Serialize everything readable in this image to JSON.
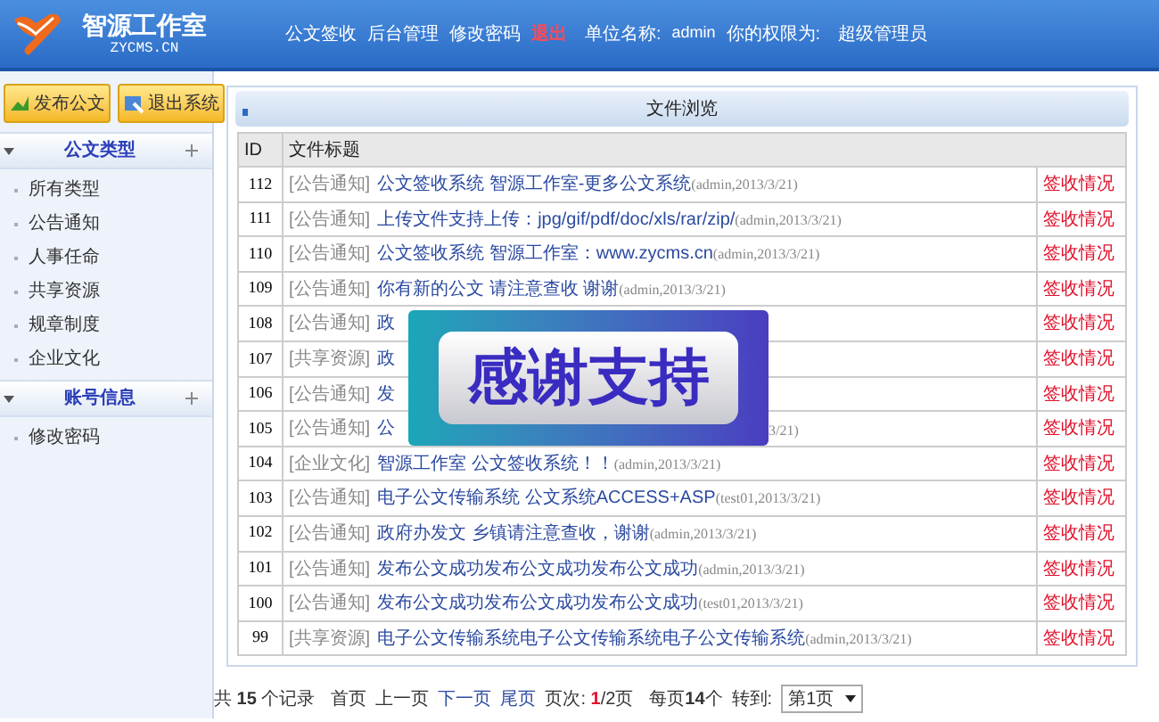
{
  "header": {
    "brand": "智源工作室",
    "domain": "ZYCMS.CN",
    "nav": [
      {
        "label": "公文签收",
        "kind": "link"
      },
      {
        "label": "后台管理",
        "kind": "link"
      },
      {
        "label": "修改密码",
        "kind": "link"
      },
      {
        "label": "退出",
        "kind": "logout"
      }
    ],
    "unit_label": "单位名称:",
    "unit_value": "admin",
    "role_label": "你的权限为:",
    "role_value": "超级管理员"
  },
  "toolbar": [
    "发布公文",
    "退出系统"
  ],
  "sidebar": [
    {
      "title": "公文类型",
      "expanded": true,
      "items": [
        "所有类型",
        "公告通知",
        "人事任命",
        "共享资源",
        "规章制度",
        "企业文化"
      ]
    },
    {
      "title": "账号信息",
      "expanded": true,
      "items": [
        "修改密码"
      ]
    }
  ],
  "panel_title": "文件浏览",
  "table": {
    "columns": [
      "ID",
      "文件标题"
    ],
    "rows": [
      {
        "id": "112",
        "category": "[公告通知]",
        "title": "公文签收系统 智源工作室-更多公文系统",
        "meta": "(admin,2013/3/21)",
        "action": "签收情况"
      },
      {
        "id": "111",
        "category": "[公告通知]",
        "title": "上传文件支持上传：jpg/gif/pdf/doc/xls/rar/zip/",
        "meta": "(admin,2013/3/21)",
        "action": "签收情况"
      },
      {
        "id": "110",
        "category": "[公告通知]",
        "title": "公文签收系统 智源工作室：www.zycms.cn",
        "meta": "(admin,2013/3/21)",
        "action": "签收情况"
      },
      {
        "id": "109",
        "category": "[公告通知]",
        "title": "你有新的公文 请注意查收 谢谢",
        "meta": "(admin,2013/3/21)",
        "action": "签收情况"
      },
      {
        "id": "108",
        "category": "[公告通知]",
        "title": "政",
        "action": "签收情况"
      },
      {
        "id": "107",
        "category": "[共享资源]",
        "title": "政",
        "action": "签收情况"
      },
      {
        "id": "106",
        "category": "[公告通知]",
        "title": "发",
        "action": "签收情况"
      },
      {
        "id": "105",
        "category": "[公告通知]",
        "title": "公",
        "tail": "3/21)",
        "action": "签收情况"
      },
      {
        "id": "104",
        "category": "[企业文化]",
        "title": "智源工作室 公文签收系统！！",
        "meta": "(admin,2013/3/21)",
        "action": "签收情况"
      },
      {
        "id": "103",
        "category": "[公告通知]",
        "title": "电子公文传输系统 公文系统ACCESS+ASP",
        "meta": "(test01,2013/3/21)",
        "action": "签收情况"
      },
      {
        "id": "102",
        "category": "[公告通知]",
        "title": "政府办发文 乡镇请注意查收，谢谢",
        "meta": "(admin,2013/3/21)",
        "action": "签收情况"
      },
      {
        "id": "101",
        "category": "[公告通知]",
        "title": "发布公文成功发布公文成功发布公文成功",
        "meta": "(admin,2013/3/21)",
        "action": "签收情况"
      },
      {
        "id": "100",
        "category": "[公告通知]",
        "title": "发布公文成功发布公文成功发布公文成功",
        "meta": "(test01,2013/3/21)",
        "action": "签收情况"
      },
      {
        "id": "99",
        "category": "[共享资源]",
        "title": "电子公文传输系统电子公文传输系统电子公文传输系统",
        "meta": "(admin,2013/3/21)",
        "action": "签收情况"
      }
    ]
  },
  "overlay": {
    "text": "感谢支持"
  },
  "pagination": {
    "total": "共 **15** 个记录",
    "links": [
      {
        "label": "首页",
        "enabled": false
      },
      {
        "label": "上一页",
        "enabled": false
      },
      {
        "label": "下一页",
        "enabled": true
      },
      {
        "label": "尾页",
        "enabled": true
      }
    ],
    "pages": "页次: **1**/2页",
    "per_page": "每页**14**个",
    "goto_label": "转到:",
    "goto_value": "第1页"
  }
}
